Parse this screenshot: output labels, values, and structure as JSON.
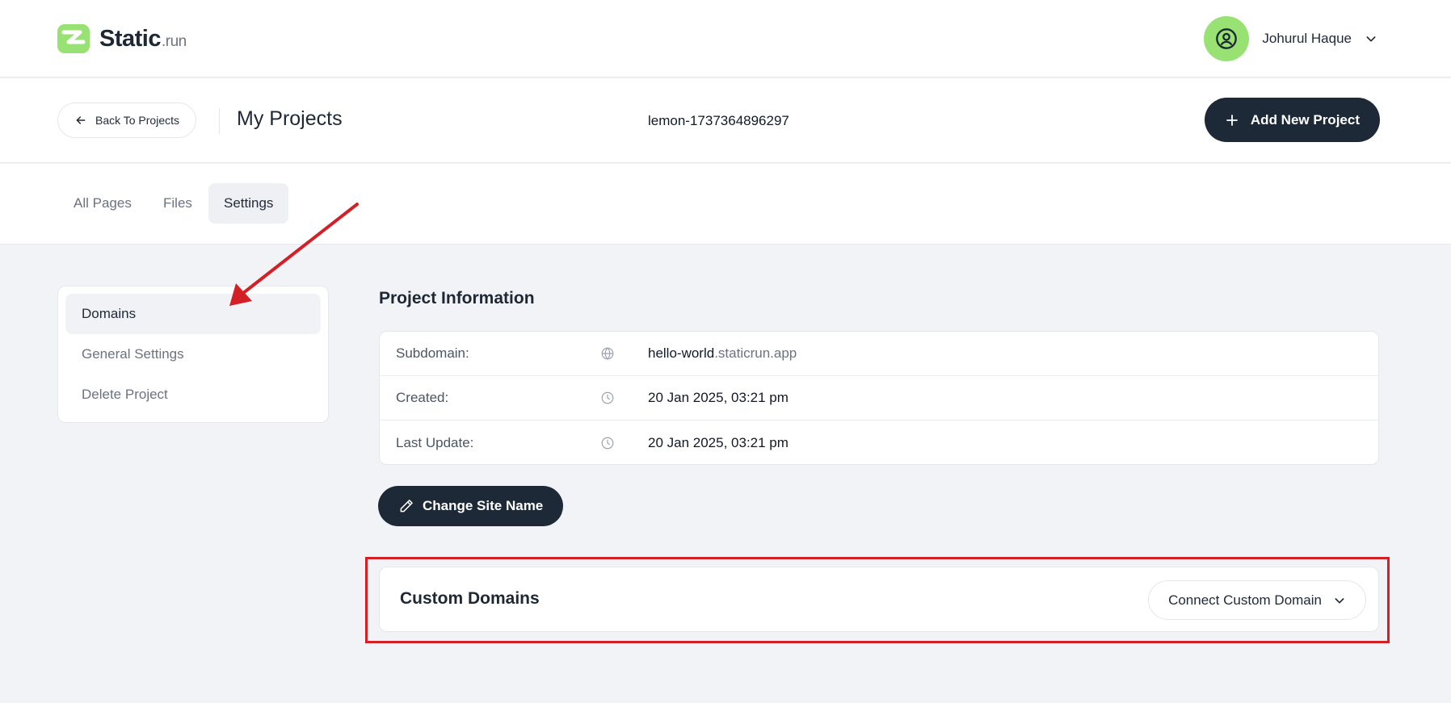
{
  "brand": {
    "name": "Static",
    "suffix": ".run"
  },
  "user": {
    "name": "Johurul Haque"
  },
  "header": {
    "back_label": "Back To Projects",
    "title": "My Projects",
    "project_id": "lemon-1737364896297",
    "add_label": "Add New Project"
  },
  "tabs": [
    {
      "label": "All Pages",
      "active": false
    },
    {
      "label": "Files",
      "active": false
    },
    {
      "label": "Settings",
      "active": true
    }
  ],
  "side_menu": [
    {
      "label": "Domains",
      "active": true
    },
    {
      "label": "General Settings",
      "active": false
    },
    {
      "label": "Delete Project",
      "active": false
    }
  ],
  "project_info": {
    "title": "Project Information",
    "rows": [
      {
        "label": "Subdomain:",
        "icon": "globe-icon",
        "value": "hello-world",
        "value_suffix": ".staticrun.app"
      },
      {
        "label": "Created:",
        "icon": "clock-icon",
        "value": "20 Jan 2025, 03:21 pm"
      },
      {
        "label": "Last Update:",
        "icon": "clock-icon",
        "value": "20 Jan 2025, 03:21 pm"
      }
    ]
  },
  "change_site_name_label": "Change Site Name",
  "custom_domains": {
    "title": "Custom Domains",
    "connect_label": "Connect Custom Domain"
  },
  "colors": {
    "accent_green": "#98e173",
    "dark_button": "#1e2938",
    "annotation_red": "#d32027"
  }
}
